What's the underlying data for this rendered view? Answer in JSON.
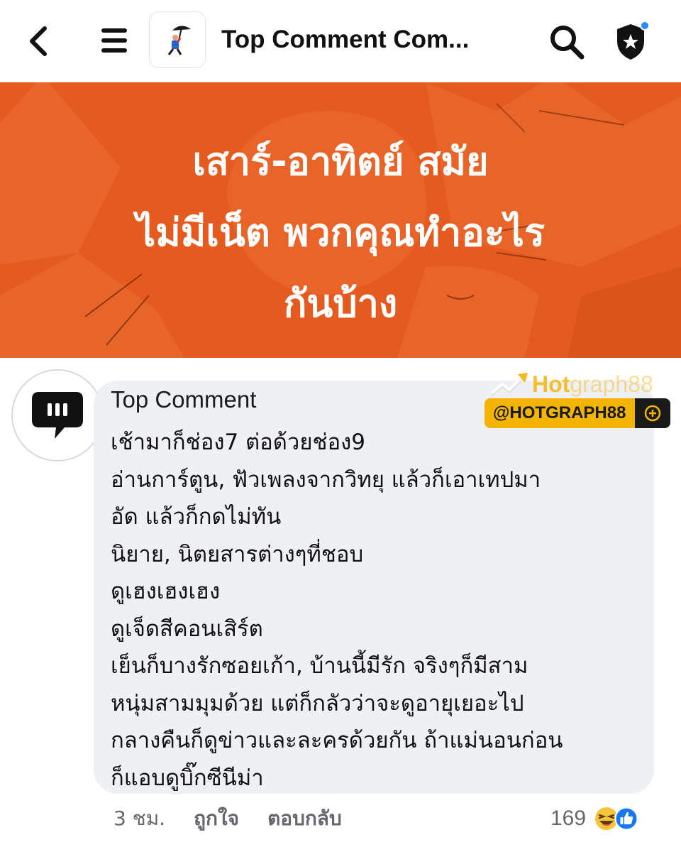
{
  "header": {
    "title": "Top Comment Com...",
    "icons": [
      "back-arrow-icon",
      "menu-icon",
      "group-avatar",
      "search-icon",
      "shield-star-icon"
    ]
  },
  "banner": {
    "lines": [
      "เสาร์-อาทิตย์ สมัย",
      "ไม่มีเน็ต พวกคุณทำอะไร",
      "กันบ้าง"
    ],
    "bg_color": "#e55a1f"
  },
  "comment": {
    "author": "Top Comment",
    "lines": [
      "เช้ามาก็ช่อง7  ต่อด้วยช่อง9",
      "อ่านการ์ตูน, ฟัวเพลงจากวิทยุ แล้วก็เอาเทปมา",
      "อัด แล้วก็กดไม่ทัน",
      "นิยาย, นิตยสารต่างๆที่ชอบ",
      "ดูเฮงเฮงเฮง",
      "ดูเจ็ดสีคอนเสิร์ต",
      "เย็นก็บางรักซอยเก้า, บ้านนี้มีรัก จริงๆก็มีสาม",
      "หนุ่มสามมุมด้วย แต่ก็กลัวว่าจะดูอายุเยอะไป",
      "กลางคืนก็ดูข่าวและละครด้วยกัน ถ้าแม่นอนก่อน",
      "ก็แอบดูบิ๊กซีนีม่า"
    ],
    "time": "3 ชม.",
    "like_label": "ถูกใจ",
    "reply_label": "ตอบกลับ",
    "reaction_count": "169",
    "reactions": [
      "laughing-emoji-icon",
      "like-thumb-icon"
    ]
  },
  "watermark": {
    "logo_hot": "Hot",
    "logo_graph": "graph88",
    "badge": "@HOTGRAPH88"
  }
}
